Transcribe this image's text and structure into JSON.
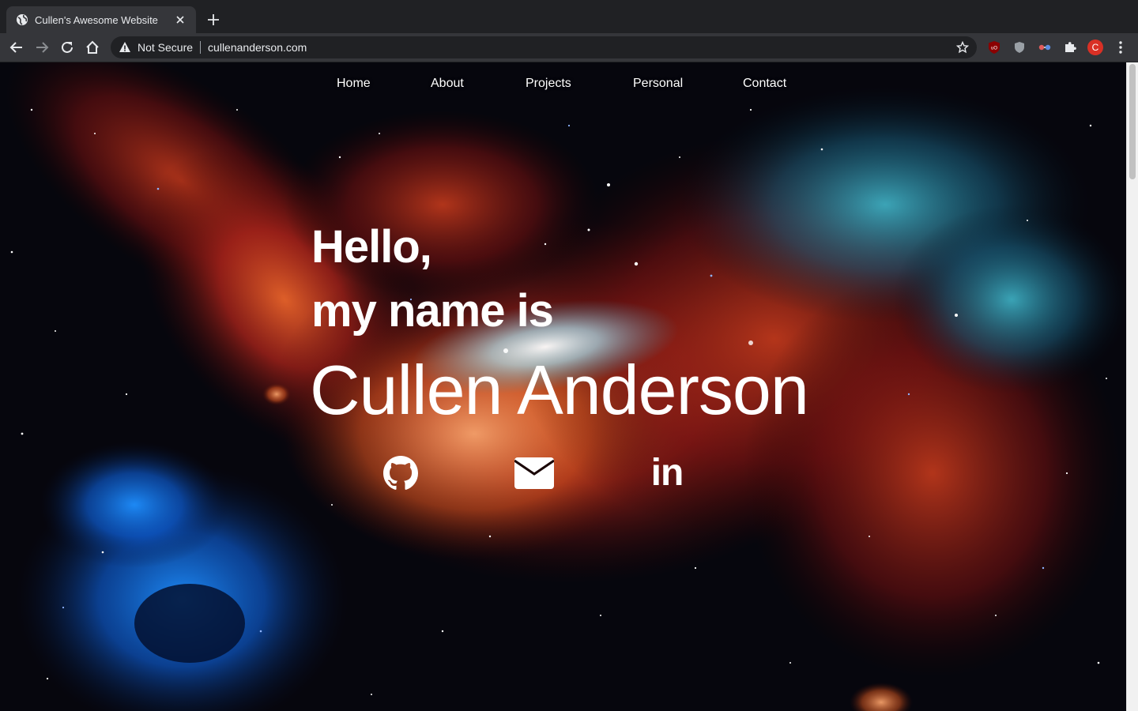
{
  "browser": {
    "tab_title": "Cullen's Awesome Website",
    "security_label": "Not Secure",
    "url": "cullenanderson.com",
    "profile_initial": "C"
  },
  "nav": {
    "items": [
      {
        "label": "Home"
      },
      {
        "label": "About"
      },
      {
        "label": "Projects"
      },
      {
        "label": "Personal"
      },
      {
        "label": "Contact"
      }
    ]
  },
  "hero": {
    "line1": "Hello,",
    "line2": "my name is",
    "name": "Cullen Anderson"
  },
  "social": {
    "links": [
      {
        "icon": "github-icon"
      },
      {
        "icon": "envelope-icon"
      },
      {
        "icon": "linkedin-icon",
        "text": "in"
      }
    ]
  },
  "colors": {
    "chrome_dark": "#202124",
    "chrome_tab": "#35363a",
    "text_white": "#ffffff",
    "avatar_red": "#d93025"
  }
}
